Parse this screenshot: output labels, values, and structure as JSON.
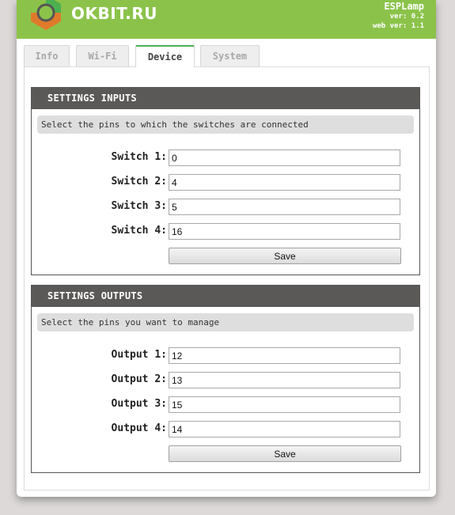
{
  "header": {
    "brand": "OKBIT.RU",
    "app_name": "ESPLamp",
    "version": "ver: 0.2",
    "web_version": "web ver: 1.1",
    "accent_color": "#8bc34a"
  },
  "tabs": [
    {
      "label": "Info",
      "active": false
    },
    {
      "label": "Wi-Fi",
      "active": false
    },
    {
      "label": "Device",
      "active": true
    },
    {
      "label": "System",
      "active": false
    }
  ],
  "inputs_panel": {
    "title": "SETTINGS INPUTS",
    "hint": "Select the pins to which the switches are connected",
    "fields": [
      {
        "label": "Switch 1:",
        "value": "0"
      },
      {
        "label": "Switch 2:",
        "value": "4"
      },
      {
        "label": "Switch 3:",
        "value": "5"
      },
      {
        "label": "Switch 4:",
        "value": "16"
      }
    ],
    "save_label": "Save"
  },
  "outputs_panel": {
    "title": "SETTINGS OUTPUTS",
    "hint": "Select the pins you want to manage",
    "fields": [
      {
        "label": "Output 1:",
        "value": "12"
      },
      {
        "label": "Output 2:",
        "value": "13"
      },
      {
        "label": "Output 3:",
        "value": "15"
      },
      {
        "label": "Output 4:",
        "value": "14"
      }
    ],
    "save_label": "Save"
  }
}
